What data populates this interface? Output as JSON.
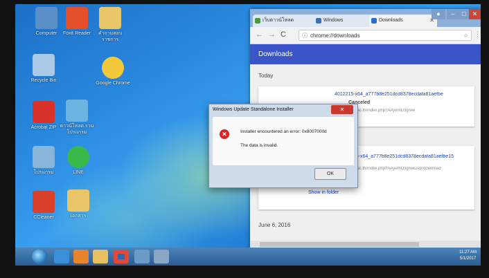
{
  "desktop": {
    "icons": [
      {
        "label": "Computer",
        "color": "#5b8fc7"
      },
      {
        "label": "Foxit Reader",
        "color": "#e4502c"
      },
      {
        "label": "คำถามสอบ ราชการ",
        "color": "#e9c66a"
      },
      {
        "label": "Recycle Bin",
        "color": "#a9c9e6"
      },
      {
        "label": "Google Chrome",
        "color": "#f3c93b"
      },
      {
        "label": "Acrobat ZIP",
        "color": "#d8322b"
      },
      {
        "label": "ดาวน์โหลด รวมโปรแกรม",
        "color": "#6bb5e0"
      },
      {
        "label": "โปรแกรม",
        "color": "#87b6d9"
      },
      {
        "label": "LINE",
        "color": "#37b94a"
      },
      {
        "label": "CCleaner",
        "color": "#d9412c"
      },
      {
        "label": "เอกสาร",
        "color": "#e9c66a"
      }
    ]
  },
  "chrome": {
    "tabs": [
      {
        "label": "เว็บดาวน์โหลด",
        "color": "#4a9b3a"
      },
      {
        "label": "Windows",
        "color": "#3a70b8"
      },
      {
        "label": "Downloads",
        "color": "#2a6fd0"
      }
    ],
    "url": "chrome://downloads",
    "header": "Downloads",
    "sections": [
      {
        "date": "Today",
        "items": [
          {
            "name": "4012215-x64_a777b8e251dcd8378ecdafa81aefbe",
            "url": "https://dl.ku.ac.th/index.php?AAyemD3grwe",
            "status": "Canceled"
          },
          {
            "name": "kb4012215-x64_a777b8e251dcd8378ecdafa81aefbe15",
            "url": "https://dl.ku.ac.th/index.php?AAyemD3grwe2ep/download",
            "action": "Show in folder"
          }
        ]
      },
      {
        "date": "June 6, 2016"
      }
    ]
  },
  "dialog": {
    "title": "Windows Update Standalone Installer",
    "message1": "Installer encountered an error: 0x8007000d",
    "message2": "The data is invalid.",
    "ok": "OK",
    "close": "✕"
  },
  "taskbar": {
    "items": [
      {
        "name": "ie",
        "color": "#3a8fd6"
      },
      {
        "name": "media-player",
        "color": "#e8832e"
      },
      {
        "name": "explorer",
        "color": "#e7c062"
      },
      {
        "name": "chrome",
        "color": "#e2483a"
      },
      {
        "name": "window",
        "color": "#6c9bc8"
      },
      {
        "name": "app",
        "color": "#8aa6c4"
      }
    ],
    "time": "11:27 AM",
    "date": "5/1/2017"
  }
}
